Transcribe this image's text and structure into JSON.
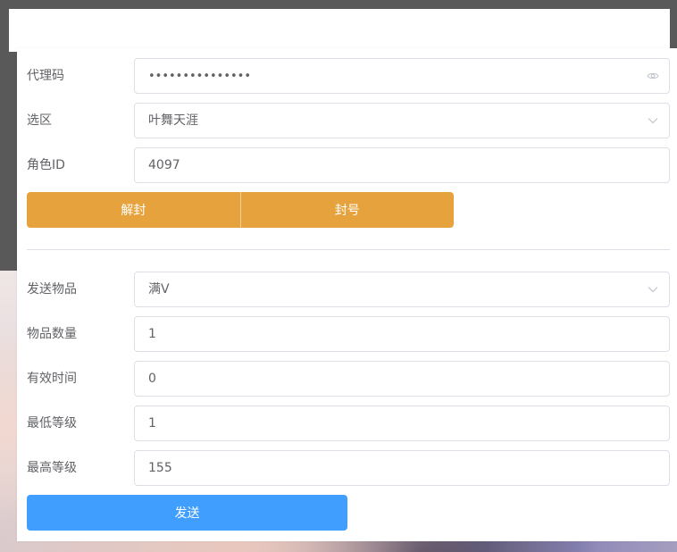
{
  "form": {
    "agent_code": {
      "label": "代理码",
      "value": "•••••••••••••••"
    },
    "zone": {
      "label": "选区",
      "value": "叶舞天涯"
    },
    "role_id": {
      "label": "角色ID",
      "value": "4097"
    },
    "unban_label": "解封",
    "ban_label": "封号",
    "item": {
      "label": "发送物品",
      "value": "满V"
    },
    "quantity": {
      "label": "物品数量",
      "value": "1"
    },
    "valid_time": {
      "label": "有效时间",
      "value": "0"
    },
    "min_level": {
      "label": "最低等级",
      "value": "1"
    },
    "max_level": {
      "label": "最高等级",
      "value": "155"
    },
    "send_label": "发送"
  },
  "icons": {
    "password_toggle": "eye-icon",
    "select_arrow": "chevron-down-icon"
  },
  "colors": {
    "warning": "#e6a23c",
    "primary": "#409eff",
    "border": "#dcdfe6",
    "text": "#606266"
  }
}
